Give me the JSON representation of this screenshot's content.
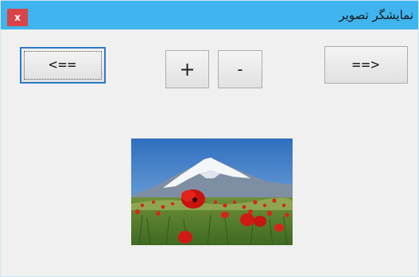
{
  "window": {
    "title": "نمایشگر تصویر",
    "close_label": "x"
  },
  "toolbar": {
    "prev_label": "<==",
    "zoom_in_label": "+",
    "zoom_out_label": "-",
    "next_label": "==>"
  },
  "image": {
    "subject": "red poppies in front of a snow-capped mountain"
  },
  "colors": {
    "titlebar": "#3fb4ee",
    "close_button": "#d9434a",
    "focus_border": "#2b79c9",
    "window_bg": "#f0f0f0"
  }
}
